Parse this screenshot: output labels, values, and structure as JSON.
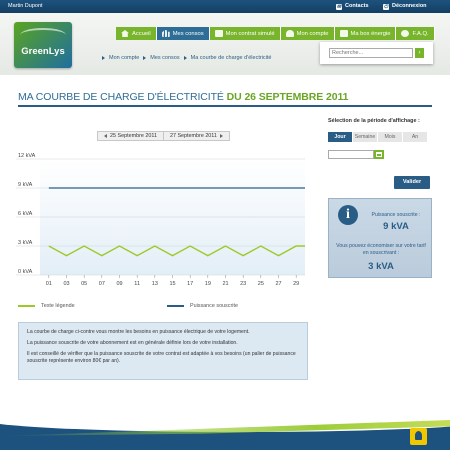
{
  "topbar": {
    "user_name": "Martin Dupont",
    "contacts_label": "Contacts",
    "logout_label": "Déconnexion"
  },
  "brand": {
    "logo_text": "GreenLys"
  },
  "nav": {
    "items": [
      {
        "label": "Accueil",
        "icon": "home-icon",
        "active": false
      },
      {
        "label": "Mes consos",
        "icon": "bar-chart-icon",
        "active": true
      },
      {
        "label": "Mon contrat simulé",
        "icon": "calendar-icon",
        "active": false
      },
      {
        "label": "Mon compte",
        "icon": "user-icon",
        "active": false
      },
      {
        "label": "Ma box énergie",
        "icon": "box-icon",
        "active": false
      },
      {
        "label": "F.A.Q.",
        "icon": "question-icon",
        "active": false
      }
    ]
  },
  "search": {
    "placeholder": "Recherche..."
  },
  "breadcrumb": [
    "Mon compte",
    "Mes consos",
    "Ma courbe de charge d'électricité"
  ],
  "page": {
    "title_prefix": "MA COURBE DE CHARGE D'ÉLECTRICITÉ",
    "title_date": "DU 26 SEPTEMBRE 2011"
  },
  "date_nav": {
    "prev_label": "25 Septembre 2011",
    "next_label": "27 Septembre 2011"
  },
  "chart_data": {
    "type": "line",
    "y_ticks": [
      "12 kVA",
      "9 kVA",
      "6 kVA",
      "3 kVA",
      "0 kVA"
    ],
    "ylim": [
      0,
      12
    ],
    "x_ticks": [
      "01",
      "03",
      "05",
      "07",
      "09",
      "11",
      "13",
      "15",
      "17",
      "19",
      "21",
      "23",
      "25",
      "27",
      "29"
    ],
    "series": [
      {
        "name": "Texte légende",
        "color": "#9cc92a",
        "x": [
          1,
          3,
          5,
          7,
          9,
          11,
          13,
          15,
          17,
          19,
          21,
          23,
          25,
          27,
          29,
          30
        ],
        "values": [
          3,
          2,
          3,
          2,
          3,
          2,
          3,
          2,
          3,
          2,
          3,
          2,
          3,
          2,
          3,
          3
        ]
      },
      {
        "name": "Puissance souscrite",
        "color": "#2a5d86",
        "x": [
          1,
          30
        ],
        "values": [
          9,
          9
        ]
      }
    ],
    "xlim": [
      0,
      30
    ],
    "grid": true
  },
  "info": {
    "p1": "La courbe de charge ci-contre vous montre les besoins en puissance électrique de votre logement.",
    "p2": "La puissance souscrite de votre abonnement est en générale définie lors de votre installation.",
    "p3": "Il est conseillé de vérifier que la puissance souscrite de votre contrat est adaptée à vos besoins (un palier de puissance souscrite représente environ 80€ par an)."
  },
  "right_panel": {
    "title": "Sélection de la période d'affichage :",
    "tabs": [
      {
        "label": "Jour",
        "active": true
      },
      {
        "label": "Semaine",
        "active": false
      },
      {
        "label": "Mois",
        "active": false
      },
      {
        "label": "An",
        "active": false
      }
    ],
    "validate_label": "Valider",
    "subscribed_label": "Puissance souscrite :",
    "subscribed_value": "9 kVA",
    "save_label": "Vous pouvez économiser sur votre tarif en souscrivant :",
    "save_value": "3 kVA"
  }
}
